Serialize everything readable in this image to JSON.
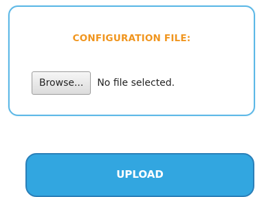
{
  "config_panel": {
    "title": "CONFIGURATION FILE:",
    "title_color": "#f0951e",
    "browse_label": "Browse...",
    "file_status": "No file selected."
  },
  "upload": {
    "label": "UPLOAD",
    "color": "#32a6e0"
  }
}
